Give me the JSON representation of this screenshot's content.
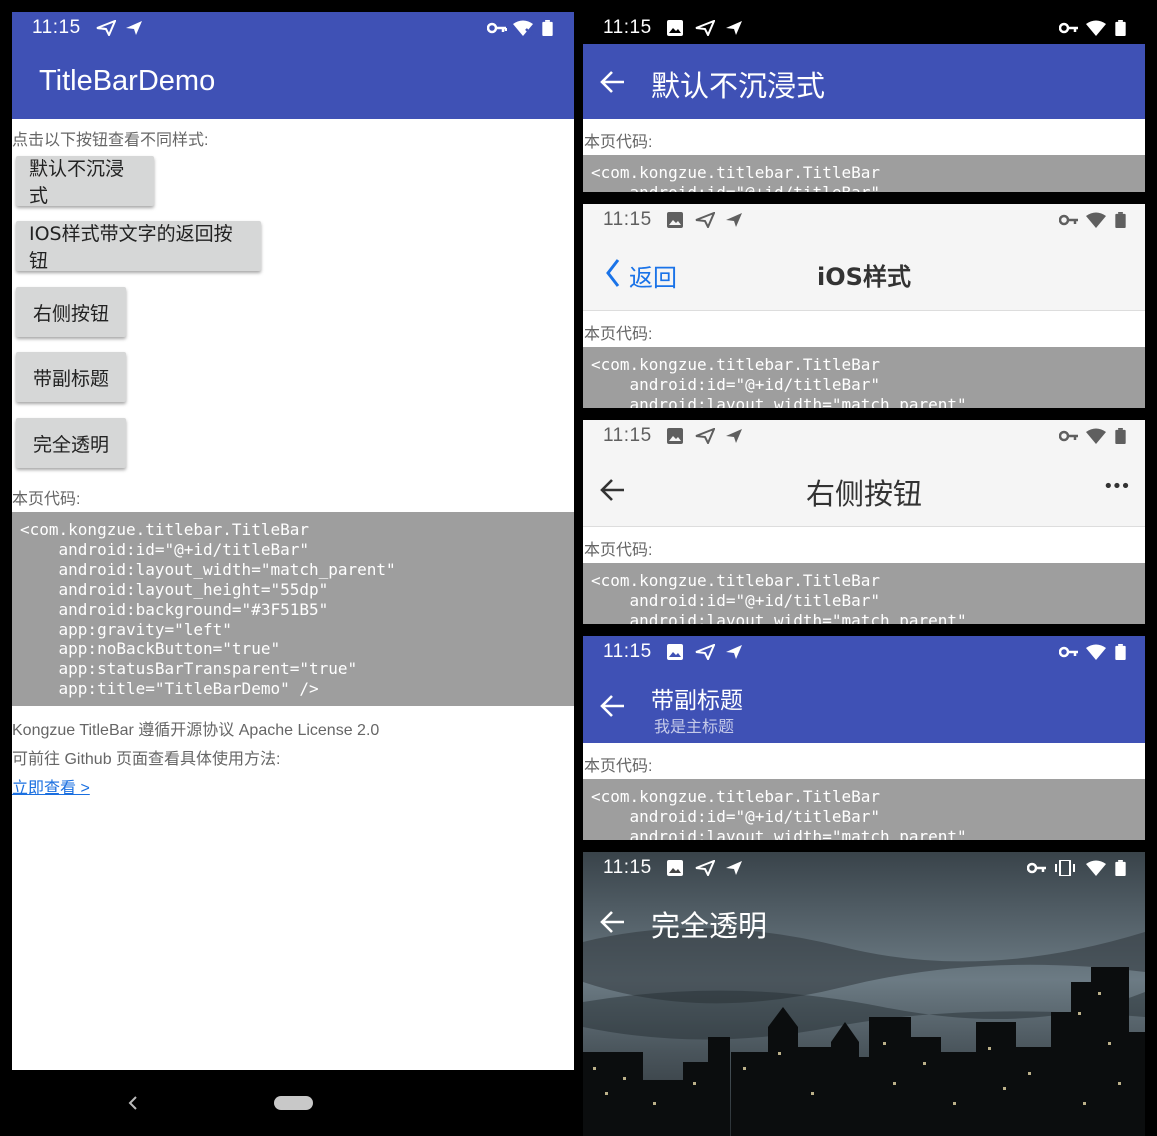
{
  "status": {
    "time": "11:15"
  },
  "left": {
    "app_title": "TitleBarDemo",
    "hint": "点击以下按钮查看不同样式:",
    "buttons": [
      "默认不沉浸式",
      "IOS样式带文字的返回按钮",
      "右侧按钮",
      "带副标题",
      "完全透明"
    ],
    "code_label": "本页代码:",
    "code": "<com.kongzue.titlebar.TitleBar\n    android:id=\"@+id/titleBar\"\n    android:layout_width=\"match_parent\"\n    android:layout_height=\"55dp\"\n    android:background=\"#3F51B5\"\n    app:gravity=\"left\"\n    app:noBackButton=\"true\"\n    app:statusBarTransparent=\"true\"\n    app:title=\"TitleBarDemo\" />",
    "license": "Kongzue TitleBar 遵循开源协议 Apache License 2.0",
    "github": "可前往 Github 页面查看具体使用方法:",
    "link": "立即查看 >"
  },
  "panels": {
    "code_label": "本页代码:",
    "code_line1": "<com.kongzue.titlebar.TitleBar",
    "code_line2": "    android:id=\"@+id/titleBar\"",
    "code_line3": "    android:layout_width=\"match_parent\"",
    "p1_title": "默认不沉浸式",
    "p2_back": "返回",
    "p2_title": "iOS样式",
    "p3_title": "右侧按钮",
    "p3_menu": "•••",
    "p4_title": "带副标题",
    "p4_subtitle": "我是主标题",
    "p5_title": "完全透明"
  },
  "colors": {
    "primary": "#3F51B5",
    "code_bg": "#9e9e9e",
    "button": "#d6d7d7",
    "ios_blue": "#1a73e8"
  },
  "icons": [
    "image-icon",
    "send-icon",
    "vpn-key-icon",
    "wifi-icon",
    "battery-icon",
    "vibrate-icon",
    "back-arrow-icon",
    "chevron-left-icon",
    "more-icon",
    "nav-back-icon",
    "nav-home-pill-icon"
  ]
}
